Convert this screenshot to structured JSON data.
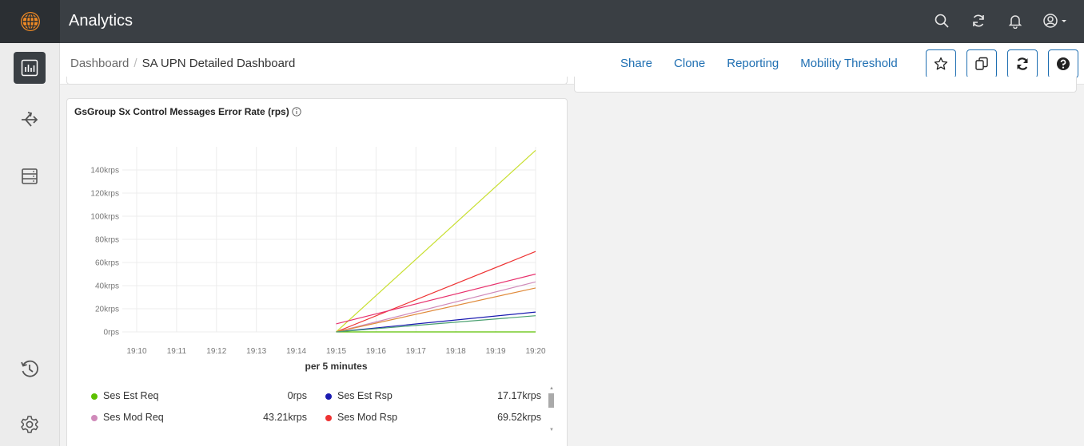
{
  "app": {
    "title": "Analytics"
  },
  "header_icons": [
    "search-icon",
    "refresh-icon",
    "bell-icon",
    "user-icon"
  ],
  "sidebar": {
    "items": [
      {
        "icon": "bar-chart-icon",
        "active": true
      },
      {
        "icon": "share-arrows-icon",
        "active": false
      },
      {
        "icon": "server-list-icon",
        "active": false
      },
      {
        "icon": "history-icon",
        "active": false
      },
      {
        "icon": "gear-icon",
        "active": false
      }
    ]
  },
  "breadcrumb": {
    "root": "Dashboard",
    "separator": "/",
    "current": "SA UPN Detailed Dashboard"
  },
  "actions": {
    "share": "Share",
    "clone": "Clone",
    "reporting": "Reporting",
    "mobility": "Mobility Threshold"
  },
  "toolbar_icons": [
    "star-icon",
    "copy-icon",
    "refresh-icon",
    "help-icon"
  ],
  "panel": {
    "title": "GsGroup Sx Control Messages Error Rate (rps)"
  },
  "chart_data": {
    "type": "line",
    "x": [
      "19:10",
      "19:11",
      "19:12",
      "19:13",
      "19:14",
      "19:15",
      "19:16",
      "19:17",
      "19:18",
      "19:19",
      "19:20"
    ],
    "xlabel": "per 5 minutes",
    "y_ticks": [
      "0rps",
      "20krps",
      "40krps",
      "60krps",
      "80krps",
      "100krps",
      "120krps",
      "140krps"
    ],
    "ylim": [
      0,
      160
    ],
    "y_unit": "krps",
    "grid": true,
    "legend_position": "bottom",
    "series": [
      {
        "name": "Ses Est Req",
        "color": "#5cc000",
        "points": [
          [
            19.15,
            0
          ],
          [
            19.2,
            0
          ]
        ]
      },
      {
        "name": "Ses Est Rsp",
        "color": "#1a1ab0",
        "points": [
          [
            19.15,
            0
          ],
          [
            19.2,
            17.17
          ]
        ]
      },
      {
        "name": "Ses Mod Req",
        "color": "#d08aba",
        "points": [
          [
            19.15,
            0
          ],
          [
            19.2,
            43.21
          ]
        ]
      },
      {
        "name": "Ses Mod Rsp",
        "color": "#ee3333",
        "points": [
          [
            19.15,
            0
          ],
          [
            19.2,
            69.52
          ]
        ]
      },
      {
        "color": "#c8df30",
        "points": [
          [
            19.15,
            0
          ],
          [
            19.2,
            157
          ]
        ]
      },
      {
        "color": "#e8326e",
        "points": [
          [
            19.15,
            7
          ],
          [
            19.2,
            50
          ]
        ]
      },
      {
        "color": "#e08a3a",
        "points": [
          [
            19.15,
            0
          ],
          [
            19.2,
            38
          ]
        ]
      },
      {
        "color": "#4aa070",
        "points": [
          [
            19.15,
            0
          ],
          [
            19.2,
            14
          ]
        ]
      }
    ]
  },
  "legend": [
    {
      "name": "Ses Est Req",
      "value": "0rps",
      "color": "#5cc000"
    },
    {
      "name": "Ses Est Rsp",
      "value": "17.17krps",
      "color": "#1a1ab0"
    },
    {
      "name": "Ses Mod Req",
      "value": "43.21krps",
      "color": "#d08aba"
    },
    {
      "name": "Ses Mod Rsp",
      "value": "69.52krps",
      "color": "#ee3333"
    }
  ]
}
